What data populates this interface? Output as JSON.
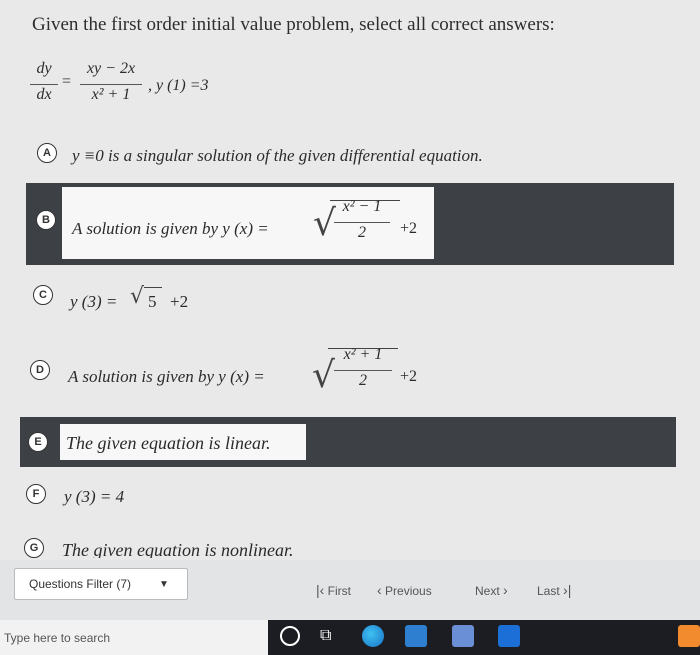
{
  "question": {
    "prompt": "Given the first order initial value problem, select all correct answers:",
    "ode_lhs_num": "dy",
    "ode_lhs_den": "dx",
    "equals": "=",
    "ode_rhs_num": "xy − 2x",
    "ode_rhs_den": "x² + 1",
    "initial_condition": ",   y (1) =3"
  },
  "options": [
    {
      "letter": "A",
      "text": "y ≡0 is a singular solution of the given differential equation."
    },
    {
      "letter": "B",
      "text": "A solution is given by  y (x) =",
      "frac_num": "x² − 1",
      "frac_den": "2",
      "tail": "+2"
    },
    {
      "letter": "C",
      "text_pre": "y (3) =",
      "sqrt_arg": "5",
      "tail": "+2"
    },
    {
      "letter": "D",
      "text": "A solution is given by  y (x) =",
      "frac_num": "x² + 1",
      "frac_den": "2",
      "tail": "+2"
    },
    {
      "letter": "E",
      "text": "The given equation is linear."
    },
    {
      "letter": "F",
      "text": "y (3) = 4"
    },
    {
      "letter": "G",
      "text": "The given equation is nonlinear."
    }
  ],
  "footer": {
    "filter_label": "Questions Filter (7)",
    "first": "First",
    "previous": "Previous",
    "next": "Next",
    "last": "Last"
  },
  "taskbar": {
    "search_placeholder": "Type here to search"
  }
}
